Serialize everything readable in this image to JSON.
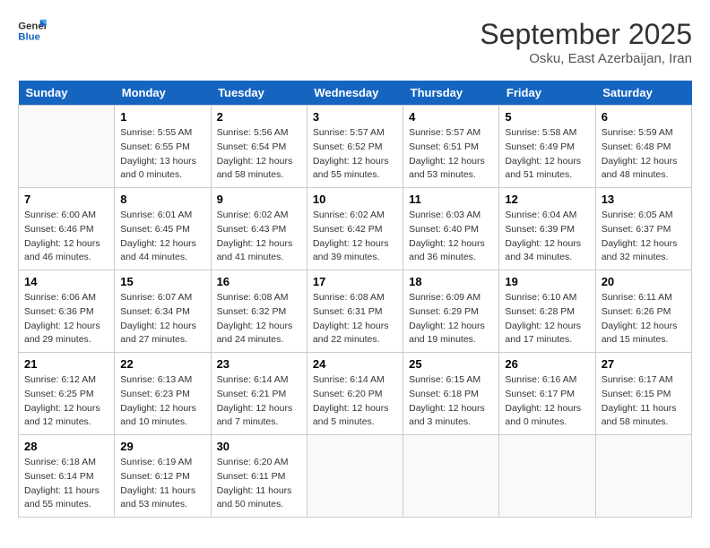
{
  "logo": {
    "line1": "General",
    "line2": "Blue"
  },
  "title": "September 2025",
  "subtitle": "Osku, East Azerbaijan, Iran",
  "days_of_week": [
    "Sunday",
    "Monday",
    "Tuesday",
    "Wednesday",
    "Thursday",
    "Friday",
    "Saturday"
  ],
  "weeks": [
    [
      {
        "day": "",
        "info": ""
      },
      {
        "day": "1",
        "info": "Sunrise: 5:55 AM\nSunset: 6:55 PM\nDaylight: 13 hours\nand 0 minutes."
      },
      {
        "day": "2",
        "info": "Sunrise: 5:56 AM\nSunset: 6:54 PM\nDaylight: 12 hours\nand 58 minutes."
      },
      {
        "day": "3",
        "info": "Sunrise: 5:57 AM\nSunset: 6:52 PM\nDaylight: 12 hours\nand 55 minutes."
      },
      {
        "day": "4",
        "info": "Sunrise: 5:57 AM\nSunset: 6:51 PM\nDaylight: 12 hours\nand 53 minutes."
      },
      {
        "day": "5",
        "info": "Sunrise: 5:58 AM\nSunset: 6:49 PM\nDaylight: 12 hours\nand 51 minutes."
      },
      {
        "day": "6",
        "info": "Sunrise: 5:59 AM\nSunset: 6:48 PM\nDaylight: 12 hours\nand 48 minutes."
      }
    ],
    [
      {
        "day": "7",
        "info": "Sunrise: 6:00 AM\nSunset: 6:46 PM\nDaylight: 12 hours\nand 46 minutes."
      },
      {
        "day": "8",
        "info": "Sunrise: 6:01 AM\nSunset: 6:45 PM\nDaylight: 12 hours\nand 44 minutes."
      },
      {
        "day": "9",
        "info": "Sunrise: 6:02 AM\nSunset: 6:43 PM\nDaylight: 12 hours\nand 41 minutes."
      },
      {
        "day": "10",
        "info": "Sunrise: 6:02 AM\nSunset: 6:42 PM\nDaylight: 12 hours\nand 39 minutes."
      },
      {
        "day": "11",
        "info": "Sunrise: 6:03 AM\nSunset: 6:40 PM\nDaylight: 12 hours\nand 36 minutes."
      },
      {
        "day": "12",
        "info": "Sunrise: 6:04 AM\nSunset: 6:39 PM\nDaylight: 12 hours\nand 34 minutes."
      },
      {
        "day": "13",
        "info": "Sunrise: 6:05 AM\nSunset: 6:37 PM\nDaylight: 12 hours\nand 32 minutes."
      }
    ],
    [
      {
        "day": "14",
        "info": "Sunrise: 6:06 AM\nSunset: 6:36 PM\nDaylight: 12 hours\nand 29 minutes."
      },
      {
        "day": "15",
        "info": "Sunrise: 6:07 AM\nSunset: 6:34 PM\nDaylight: 12 hours\nand 27 minutes."
      },
      {
        "day": "16",
        "info": "Sunrise: 6:08 AM\nSunset: 6:32 PM\nDaylight: 12 hours\nand 24 minutes."
      },
      {
        "day": "17",
        "info": "Sunrise: 6:08 AM\nSunset: 6:31 PM\nDaylight: 12 hours\nand 22 minutes."
      },
      {
        "day": "18",
        "info": "Sunrise: 6:09 AM\nSunset: 6:29 PM\nDaylight: 12 hours\nand 19 minutes."
      },
      {
        "day": "19",
        "info": "Sunrise: 6:10 AM\nSunset: 6:28 PM\nDaylight: 12 hours\nand 17 minutes."
      },
      {
        "day": "20",
        "info": "Sunrise: 6:11 AM\nSunset: 6:26 PM\nDaylight: 12 hours\nand 15 minutes."
      }
    ],
    [
      {
        "day": "21",
        "info": "Sunrise: 6:12 AM\nSunset: 6:25 PM\nDaylight: 12 hours\nand 12 minutes."
      },
      {
        "day": "22",
        "info": "Sunrise: 6:13 AM\nSunset: 6:23 PM\nDaylight: 12 hours\nand 10 minutes."
      },
      {
        "day": "23",
        "info": "Sunrise: 6:14 AM\nSunset: 6:21 PM\nDaylight: 12 hours\nand 7 minutes."
      },
      {
        "day": "24",
        "info": "Sunrise: 6:14 AM\nSunset: 6:20 PM\nDaylight: 12 hours\nand 5 minutes."
      },
      {
        "day": "25",
        "info": "Sunrise: 6:15 AM\nSunset: 6:18 PM\nDaylight: 12 hours\nand 3 minutes."
      },
      {
        "day": "26",
        "info": "Sunrise: 6:16 AM\nSunset: 6:17 PM\nDaylight: 12 hours\nand 0 minutes."
      },
      {
        "day": "27",
        "info": "Sunrise: 6:17 AM\nSunset: 6:15 PM\nDaylight: 11 hours\nand 58 minutes."
      }
    ],
    [
      {
        "day": "28",
        "info": "Sunrise: 6:18 AM\nSunset: 6:14 PM\nDaylight: 11 hours\nand 55 minutes."
      },
      {
        "day": "29",
        "info": "Sunrise: 6:19 AM\nSunset: 6:12 PM\nDaylight: 11 hours\nand 53 minutes."
      },
      {
        "day": "30",
        "info": "Sunrise: 6:20 AM\nSunset: 6:11 PM\nDaylight: 11 hours\nand 50 minutes."
      },
      {
        "day": "",
        "info": ""
      },
      {
        "day": "",
        "info": ""
      },
      {
        "day": "",
        "info": ""
      },
      {
        "day": "",
        "info": ""
      }
    ]
  ]
}
